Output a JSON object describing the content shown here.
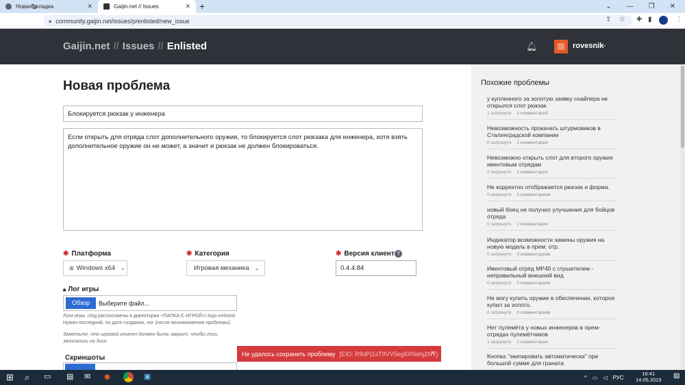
{
  "browser": {
    "tabs": [
      {
        "label": "Новая вкладка"
      },
      {
        "label": "Gaijin.net // Issues"
      }
    ],
    "new_tab": "+",
    "url": "community.gaijin.net/issues/p/enlisted/new_issue"
  },
  "header": {
    "crumbs": [
      "Gaijin.net",
      "Issues",
      "Enlisted"
    ],
    "separator": "//",
    "username": "rovesnik"
  },
  "form": {
    "page_title": "Новая проблема",
    "title_value": "Блокируется рюкзак у инженера",
    "body_value": "Если открыть для отряда слот дополнительного оружия, то блокируется слот рюкзака для инженера, хотя взять дополнительное оружие он не может, а значит и рюкзак не должен блокироваться.",
    "platform_label": "Платформа",
    "platform_value": "Windows x64",
    "category_label": "Категория",
    "category_value": "Игровая механика",
    "version_label": "Версия клиента",
    "version_value": "0.4.4.84",
    "log_label": "Лог игры",
    "browse_label": "Обзор",
    "file_placeholder": "Выберите файл...",
    "log_hint": "Логи игры .clog расположены в директории <ПАПКА-С-ИГРОЙ>/.logs-enlisted. Нужен последний, по дате создания, лог (после возникновения проблемы).",
    "log_hint2": "Заметьте, что игровой клиент должен быть закрыт, чтобы логи записались на диск.",
    "screenshots_label": "Скриншоты"
  },
  "toast": {
    "message": "Не удалось сохранить проблему",
    "eid": "[EID: R9dPj1sT9VV5eg8XNehj2NY]",
    "close": "×"
  },
  "sidebar": {
    "title": "Похожие проблемы",
    "items": [
      {
        "title": "у купленного за золотую заявку снайпера не открылся слот рюкзак",
        "affected": "1 затронуто",
        "comments": "1 комментарий"
      },
      {
        "title": "Невозможность прокачать штурмовиков в Сталинградской компании",
        "affected": "0 затронуто",
        "comments": "1 комментарий"
      },
      {
        "title": "Невозможно открыть слот для второго оружия ивентовым отрядам",
        "affected": "2 затронуто",
        "comments": "2 комментария"
      },
      {
        "title": "Не корректно отображается рюкзак и форма.",
        "affected": "0 затронуто",
        "comments": "0 комментариев"
      },
      {
        "title": "новый боец не получил улучшения для бойцов отряда",
        "affected": "0 затронуто",
        "comments": "2 комментария"
      },
      {
        "title": "Индикатор возможности замены оружия на новую модель в прем. отр.",
        "affected": "0 затронуто",
        "comments": "0 комментариев"
      },
      {
        "title": "Ивентовый отряд MP40 с глушителем - неправильный внешний вид",
        "affected": "0 затронуто",
        "comments": "0 комментариев"
      },
      {
        "title": "Не могу купить оружие в обеспечении, которое купил за золото.",
        "affected": "0 затронуто",
        "comments": "0 комментариев"
      },
      {
        "title": "Нет пулемёта у новых инженеров в прем-отрядах пулемётчиков",
        "affected": "1 затронуто",
        "comments": "2 комментария"
      },
      {
        "title": "Кнопка \"экипировать автоматически\" при большой сумме для граната",
        "affected": "",
        "comments": ""
      }
    ]
  },
  "taskbar": {
    "lang": "РУС",
    "time": "16:41",
    "date": "14.05.2023"
  },
  "colors": {
    "header_bg": "#2f3238",
    "accent_blue": "#2d6bd1",
    "error_red": "#d53a3c",
    "sidebar_bg": "#f1f1f1"
  }
}
